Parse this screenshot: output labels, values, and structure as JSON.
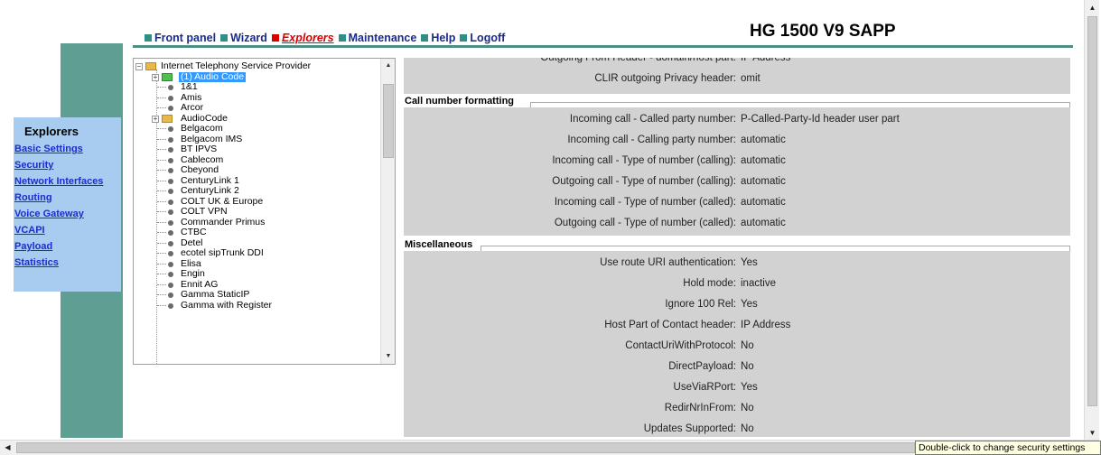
{
  "top_nav": [
    {
      "label": "Front panel",
      "active": false
    },
    {
      "label": "Wizard",
      "active": false
    },
    {
      "label": "Explorers",
      "active": true
    },
    {
      "label": "Maintenance",
      "active": false
    },
    {
      "label": "Help",
      "active": false
    },
    {
      "label": "Logoff",
      "active": false
    }
  ],
  "app_title": "HG 1500 V9 SAPP",
  "explorers": {
    "heading": "Explorers",
    "links": [
      "Basic Settings",
      "Security",
      "Network Interfaces",
      "Routing",
      "Voice Gateway",
      "VCAPI",
      "Payload",
      "Statistics"
    ]
  },
  "tree": {
    "root": "Internet Telephony Service Provider",
    "items": [
      {
        "label": "(1) Audio Code",
        "kind": "folder-green",
        "selected": true
      },
      {
        "label": "1&1",
        "kind": "leaf"
      },
      {
        "label": "Amis",
        "kind": "leaf"
      },
      {
        "label": "Arcor",
        "kind": "leaf"
      },
      {
        "label": "AudioCode",
        "kind": "folder"
      },
      {
        "label": "Belgacom",
        "kind": "leaf"
      },
      {
        "label": "Belgacom IMS",
        "kind": "leaf"
      },
      {
        "label": "BT IPVS",
        "kind": "leaf"
      },
      {
        "label": "Cablecom",
        "kind": "leaf"
      },
      {
        "label": "Cbeyond",
        "kind": "leaf"
      },
      {
        "label": "CenturyLink 1",
        "kind": "leaf"
      },
      {
        "label": "CenturyLink 2",
        "kind": "leaf"
      },
      {
        "label": "COLT UK & Europe",
        "kind": "leaf"
      },
      {
        "label": "COLT VPN",
        "kind": "leaf"
      },
      {
        "label": "Commander Primus",
        "kind": "leaf"
      },
      {
        "label": "CTBC",
        "kind": "leaf"
      },
      {
        "label": "Detel",
        "kind": "leaf"
      },
      {
        "label": "ecotel sipTrunk DDI",
        "kind": "leaf"
      },
      {
        "label": "Elisa",
        "kind": "leaf"
      },
      {
        "label": "Engin",
        "kind": "leaf"
      },
      {
        "label": "Ennit AG",
        "kind": "leaf"
      },
      {
        "label": "Gamma StaticIP",
        "kind": "leaf"
      },
      {
        "label": "Gamma with Register",
        "kind": "leaf"
      }
    ]
  },
  "details": {
    "top_rows": [
      {
        "label": "Outgoing From Header - domain/host part:",
        "value": "IP Address"
      },
      {
        "label": "CLIR outgoing Privacy header:",
        "value": "omit"
      }
    ],
    "sections": [
      {
        "title": "Call number formatting",
        "rows": [
          {
            "label": "Incoming call - Called party number:",
            "value": "P-Called-Party-Id header user part"
          },
          {
            "label": "Incoming call - Calling party number:",
            "value": "automatic"
          },
          {
            "label": "Incoming call - Type of number (calling):",
            "value": "automatic"
          },
          {
            "label": "Outgoing call - Type of number (calling):",
            "value": "automatic"
          },
          {
            "label": "Incoming call - Type of number (called):",
            "value": "automatic"
          },
          {
            "label": "Outgoing call - Type of number (called):",
            "value": "automatic"
          }
        ]
      },
      {
        "title": "Miscellaneous",
        "rows": [
          {
            "label": "Use route URI authentication:",
            "value": "Yes"
          },
          {
            "label": "Hold mode:",
            "value": "inactive"
          },
          {
            "label": "Ignore 100 Rel:",
            "value": "Yes"
          },
          {
            "label": "Host Part of Contact header:",
            "value": "IP Address"
          },
          {
            "label": "ContactUriWithProtocol:",
            "value": "No"
          },
          {
            "label": "DirectPayload:",
            "value": "No"
          },
          {
            "label": "UseViaRPort:",
            "value": "Yes"
          },
          {
            "label": "RedirNrInFrom:",
            "value": "No"
          },
          {
            "label": "Updates Supported:",
            "value": "No"
          }
        ]
      }
    ]
  },
  "tooltip": "Double-click to change security settings",
  "icons": {
    "scroll_up": "▲",
    "scroll_down": "▼",
    "scroll_left": "◀",
    "scroll_right": "▶",
    "expand": "+",
    "collapse": "−"
  },
  "colors": {
    "teal": "#5f9e93",
    "nav_text": "#1a2a8a",
    "nav_active": "#d90000",
    "explorers_bg": "#a8ccf0",
    "link": "#1d2bd0",
    "selection": "#3399ff",
    "detail_bg": "#d2d2d2"
  }
}
